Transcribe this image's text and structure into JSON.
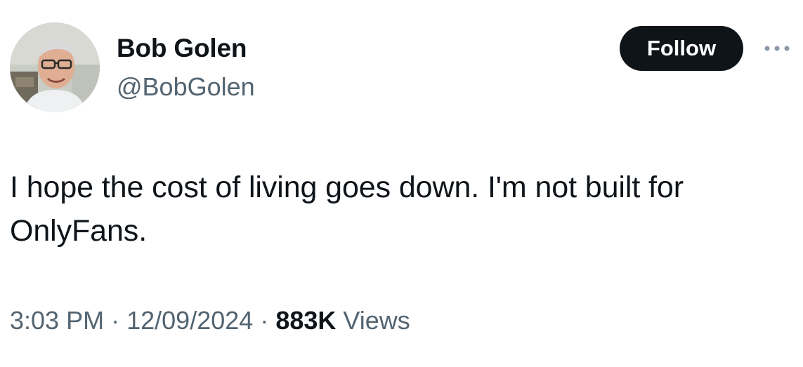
{
  "author": {
    "display_name": "Bob Golen",
    "handle": "@BobGolen"
  },
  "actions": {
    "follow_label": "Follow",
    "more_icon": "more-horizontal-icon"
  },
  "tweet": {
    "text_line1": "I hope the cost of living goes down. I'm not built for",
    "text_line2": "OnlyFans."
  },
  "meta": {
    "time": "3:03 PM",
    "separator": "·",
    "date": "12/09/2024",
    "views_count": "883K",
    "views_label": "Views"
  },
  "colors": {
    "text_primary": "#0f1419",
    "text_secondary": "#536471",
    "button_bg": "#0f1419",
    "button_text": "#ffffff",
    "more_icon": "#8b98a5"
  }
}
